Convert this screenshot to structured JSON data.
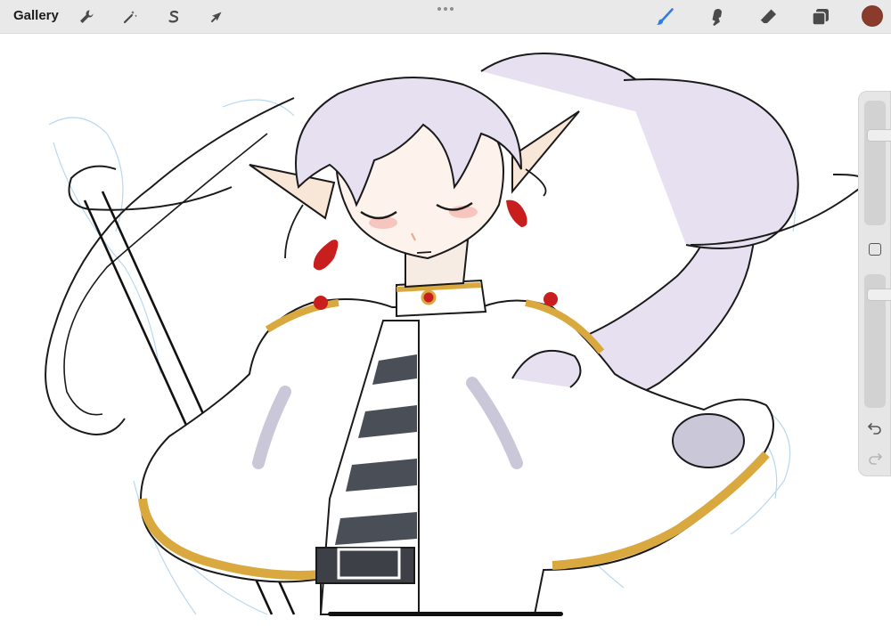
{
  "toolbar": {
    "gallery_label": "Gallery",
    "left_tools": [
      {
        "name": "actions",
        "icon": "wrench-icon"
      },
      {
        "name": "adjustments",
        "icon": "magic-wand-icon"
      },
      {
        "name": "selection",
        "icon": "selection-s-icon"
      },
      {
        "name": "transform",
        "icon": "arrow-cursor-icon"
      }
    ],
    "right_tools": [
      {
        "name": "brush",
        "icon": "brush-icon",
        "active": true
      },
      {
        "name": "smudge",
        "icon": "smudge-icon"
      },
      {
        "name": "eraser",
        "icon": "eraser-icon"
      },
      {
        "name": "layers",
        "icon": "layers-icon"
      }
    ],
    "current_color": "#8a3b2c",
    "accent_color": "#2f7de1"
  },
  "sidebar": {
    "brush_size_level": 0.25,
    "opacity_level": 0.12,
    "buttons": [
      "modify-button",
      "undo-icon",
      "redo-icon"
    ]
  },
  "canvas": {
    "subject": "drawing"
  }
}
